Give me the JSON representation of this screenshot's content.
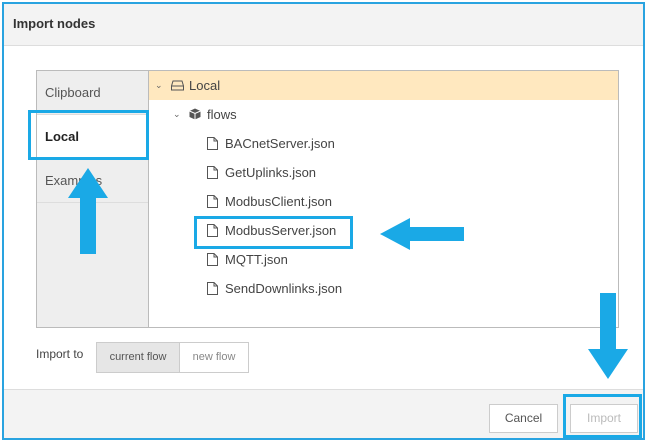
{
  "dialog": {
    "title": "Import nodes"
  },
  "tabs": [
    {
      "label": "Clipboard"
    },
    {
      "label": "Local"
    },
    {
      "label": "Examples"
    }
  ],
  "tree": {
    "root": "Local",
    "folder": "flows",
    "files": [
      "BACnetServer.json",
      "GetUplinks.json",
      "ModbusClient.json",
      "ModbusServer.json",
      "MQTT.json",
      "SendDownlinks.json"
    ]
  },
  "import_to": {
    "label": "Import to",
    "options": [
      "current flow",
      "new flow"
    ],
    "selected": "current flow"
  },
  "footer": {
    "cancel_label": "Cancel",
    "import_label": "Import"
  },
  "colors": {
    "highlight": "#1aa9e6",
    "selected_row": "#ffe8bf",
    "dialog_border": "#29a3e0"
  }
}
